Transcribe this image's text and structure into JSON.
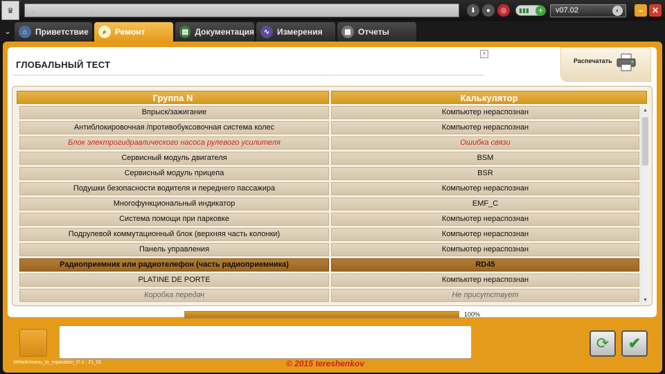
{
  "topbar": {
    "version": "v07.02",
    "battery_label": "▮▮▮"
  },
  "tabs": [
    {
      "label": "Приветствие",
      "icon": "home-icon",
      "active": false
    },
    {
      "label": "Ремонт",
      "icon": "magnifier-icon",
      "active": true
    },
    {
      "label": "Документация",
      "icon": "book-icon",
      "active": false
    },
    {
      "label": "Измерения",
      "icon": "waveform-icon",
      "active": false
    },
    {
      "label": "Отчеты",
      "icon": "report-icon",
      "active": false
    }
  ],
  "page": {
    "title": "ГЛОБАЛЬНЫЙ ТЕСТ",
    "print_label": "Распечатать"
  },
  "table": {
    "columns": [
      "Группа N",
      "Калькулятор"
    ],
    "rows": [
      {
        "group": "Впрыск/зажигание",
        "calculator": "Компьютер нераспознан",
        "state": "normal"
      },
      {
        "group": "Антиблокировочная /противобуксовочная система колес",
        "calculator": "Компьютер нераспознан",
        "state": "normal"
      },
      {
        "group": "Блок электрогидравлического насоса рулевого усилителя",
        "calculator": "Ошибка связи",
        "state": "error"
      },
      {
        "group": "Сервисный модуль двигателя",
        "calculator": "BSM",
        "state": "normal"
      },
      {
        "group": "Сервисный модуль прицепа",
        "calculator": "BSR",
        "state": "normal"
      },
      {
        "group": "Подушки безопасности водителя и переднего пассажира",
        "calculator": "Компьютер нераспознан",
        "state": "normal"
      },
      {
        "group": "Многофункциональный индикатор",
        "calculator": "EMF_C",
        "state": "normal"
      },
      {
        "group": "Система помощи при парковке",
        "calculator": "Компьютер нераспознан",
        "state": "normal"
      },
      {
        "group": "Подрулевой коммутационный блок (верхняя часть колонки)",
        "calculator": "Компьютер нераспознан",
        "state": "normal"
      },
      {
        "group": "Панель управления",
        "calculator": "Компьютер нераспознан",
        "state": "normal"
      },
      {
        "group": "Радиоприемник или радиотелефон (часть радиоприемника)",
        "calculator": "RD45",
        "state": "selected"
      },
      {
        "group": "PLATINE DE PORTE",
        "calculator": "Компьютер нераспознан",
        "state": "normal"
      },
      {
        "group": "Коробка передач",
        "calculator": "Не присутствует",
        "state": "absent"
      }
    ]
  },
  "progress": {
    "percent": 100,
    "label": "100%"
  },
  "footer": {
    "screen_id": "Vehicle\\menu_to_reparation_t7.s : 21_01",
    "watermark": "© 2015 tereshenkov"
  },
  "colors": {
    "accent": "#e59b1a",
    "error_text": "#d42020",
    "selected_row": "#a26e28"
  }
}
